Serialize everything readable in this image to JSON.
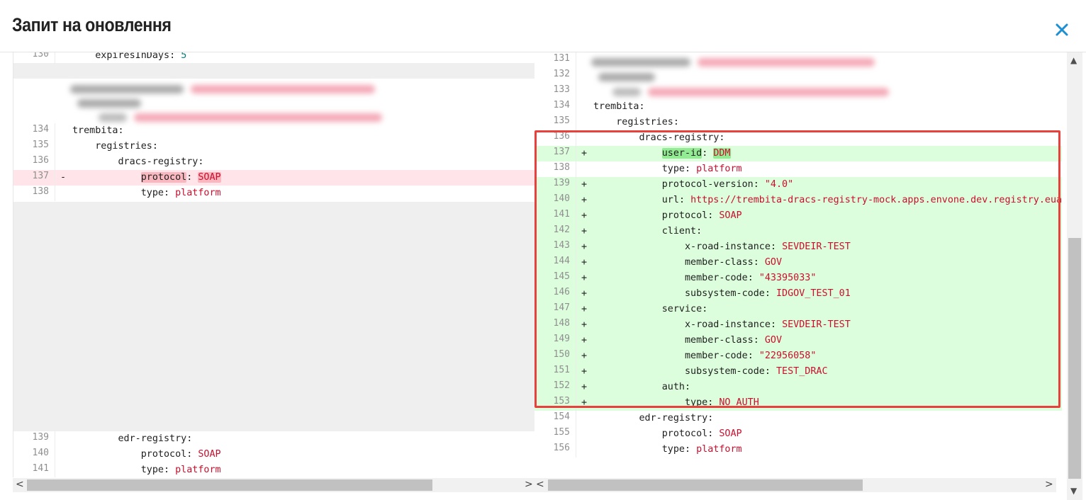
{
  "dialog": {
    "title": "Запит на оновлення",
    "close_icon": "close-icon"
  },
  "left_lines": [
    {
      "num": "130",
      "marker": "",
      "indent": "    ",
      "key": "expiresInDays",
      "value": "5",
      "vtype": "n",
      "state": "normal"
    },
    {
      "num": "134",
      "marker": "",
      "indent": "",
      "key": "trembita",
      "value": "",
      "vtype": "",
      "state": "normal"
    },
    {
      "num": "135",
      "marker": "",
      "indent": "    ",
      "key": "registries",
      "value": "",
      "vtype": "",
      "state": "normal"
    },
    {
      "num": "136",
      "marker": "",
      "indent": "        ",
      "key": "dracs-registry",
      "value": "",
      "vtype": "",
      "state": "normal"
    },
    {
      "num": "137",
      "marker": "-",
      "indent": "            ",
      "key": "protocol",
      "value": "SOAP",
      "vtype": "v",
      "state": "removed",
      "hl": "red"
    },
    {
      "num": "138",
      "marker": "",
      "indent": "            ",
      "key": "type",
      "value": "platform",
      "vtype": "v",
      "state": "normal"
    },
    {
      "num": "139",
      "marker": "",
      "indent": "        ",
      "key": "edr-registry",
      "value": "",
      "vtype": "",
      "state": "normal"
    },
    {
      "num": "140",
      "marker": "",
      "indent": "            ",
      "key": "protocol",
      "value": "SOAP",
      "vtype": "v",
      "state": "normal"
    },
    {
      "num": "141",
      "marker": "",
      "indent": "            ",
      "key": "type",
      "value": "platform",
      "vtype": "v",
      "state": "normal"
    }
  ],
  "right_lines": [
    {
      "num": "131",
      "marker": "",
      "indent": "",
      "key": "",
      "value": "",
      "vtype": "",
      "state": "normal"
    },
    {
      "num": "132",
      "marker": "",
      "indent": "",
      "key": "",
      "value": "",
      "vtype": "",
      "state": "normal"
    },
    {
      "num": "133",
      "marker": "",
      "indent": "",
      "key": "",
      "value": "",
      "vtype": "",
      "state": "normal"
    },
    {
      "num": "134",
      "marker": "",
      "indent": "",
      "key": "trembita",
      "value": "",
      "vtype": "",
      "state": "normal"
    },
    {
      "num": "135",
      "marker": "",
      "indent": "    ",
      "key": "registries",
      "value": "",
      "vtype": "",
      "state": "normal"
    },
    {
      "num": "136",
      "marker": "",
      "indent": "        ",
      "key": "dracs-registry",
      "value": "",
      "vtype": "",
      "state": "normal"
    },
    {
      "num": "137",
      "marker": "+",
      "indent": "            ",
      "key": "user-id",
      "value": "DDM",
      "vtype": "v",
      "state": "added",
      "hl": "green"
    },
    {
      "num": "138",
      "marker": "",
      "indent": "            ",
      "key": "type",
      "value": "platform",
      "vtype": "v",
      "state": "normal"
    },
    {
      "num": "139",
      "marker": "+",
      "indent": "            ",
      "key": "protocol-version",
      "value": "\"4.0\"",
      "vtype": "v",
      "state": "added"
    },
    {
      "num": "140",
      "marker": "+",
      "indent": "            ",
      "key": "url",
      "value": "https://trembita-dracs-registry-mock.apps.envone.dev.registry.eua",
      "vtype": "v",
      "state": "added"
    },
    {
      "num": "141",
      "marker": "+",
      "indent": "            ",
      "key": "protocol",
      "value": "SOAP",
      "vtype": "v",
      "state": "added"
    },
    {
      "num": "142",
      "marker": "+",
      "indent": "            ",
      "key": "client",
      "value": "",
      "vtype": "",
      "state": "added"
    },
    {
      "num": "143",
      "marker": "+",
      "indent": "                ",
      "key": "x-road-instance",
      "value": "SEVDEIR-TEST",
      "vtype": "v",
      "state": "added"
    },
    {
      "num": "144",
      "marker": "+",
      "indent": "                ",
      "key": "member-class",
      "value": "GOV",
      "vtype": "v",
      "state": "added"
    },
    {
      "num": "145",
      "marker": "+",
      "indent": "                ",
      "key": "member-code",
      "value": "\"43395033\"",
      "vtype": "v",
      "state": "added"
    },
    {
      "num": "146",
      "marker": "+",
      "indent": "                ",
      "key": "subsystem-code",
      "value": "IDGOV_TEST_01",
      "vtype": "v",
      "state": "added"
    },
    {
      "num": "147",
      "marker": "+",
      "indent": "            ",
      "key": "service",
      "value": "",
      "vtype": "",
      "state": "added"
    },
    {
      "num": "148",
      "marker": "+",
      "indent": "                ",
      "key": "x-road-instance",
      "value": "SEVDEIR-TEST",
      "vtype": "v",
      "state": "added"
    },
    {
      "num": "149",
      "marker": "+",
      "indent": "                ",
      "key": "member-class",
      "value": "GOV",
      "vtype": "v",
      "state": "added"
    },
    {
      "num": "150",
      "marker": "+",
      "indent": "                ",
      "key": "member-code",
      "value": "\"22956058\"",
      "vtype": "v",
      "state": "added"
    },
    {
      "num": "151",
      "marker": "+",
      "indent": "                ",
      "key": "subsystem-code",
      "value": "TEST_DRAC",
      "vtype": "v",
      "state": "added"
    },
    {
      "num": "152",
      "marker": "+",
      "indent": "            ",
      "key": "auth",
      "value": "",
      "vtype": "",
      "state": "added"
    },
    {
      "num": "153",
      "marker": "+",
      "indent": "                ",
      "key": "type",
      "value": "NO_AUTH",
      "vtype": "v",
      "state": "added"
    },
    {
      "num": "154",
      "marker": "",
      "indent": "        ",
      "key": "edr-registry",
      "value": "",
      "vtype": "",
      "state": "normal"
    },
    {
      "num": "155",
      "marker": "",
      "indent": "            ",
      "key": "protocol",
      "value": "SOAP",
      "vtype": "v",
      "state": "normal"
    },
    {
      "num": "156",
      "marker": "",
      "indent": "            ",
      "key": "type",
      "value": "platform",
      "vtype": "v",
      "state": "normal"
    }
  ],
  "scrollbar": {
    "left_arrow": "<",
    "right_arrow": ">",
    "up_arrow": "▲",
    "down_arrow": "▼"
  },
  "colors": {
    "added_bg": "#dcfedc",
    "removed_bg": "#ffe5e9",
    "value_text": "#c8102e",
    "highlight_border": "#e8413d"
  }
}
